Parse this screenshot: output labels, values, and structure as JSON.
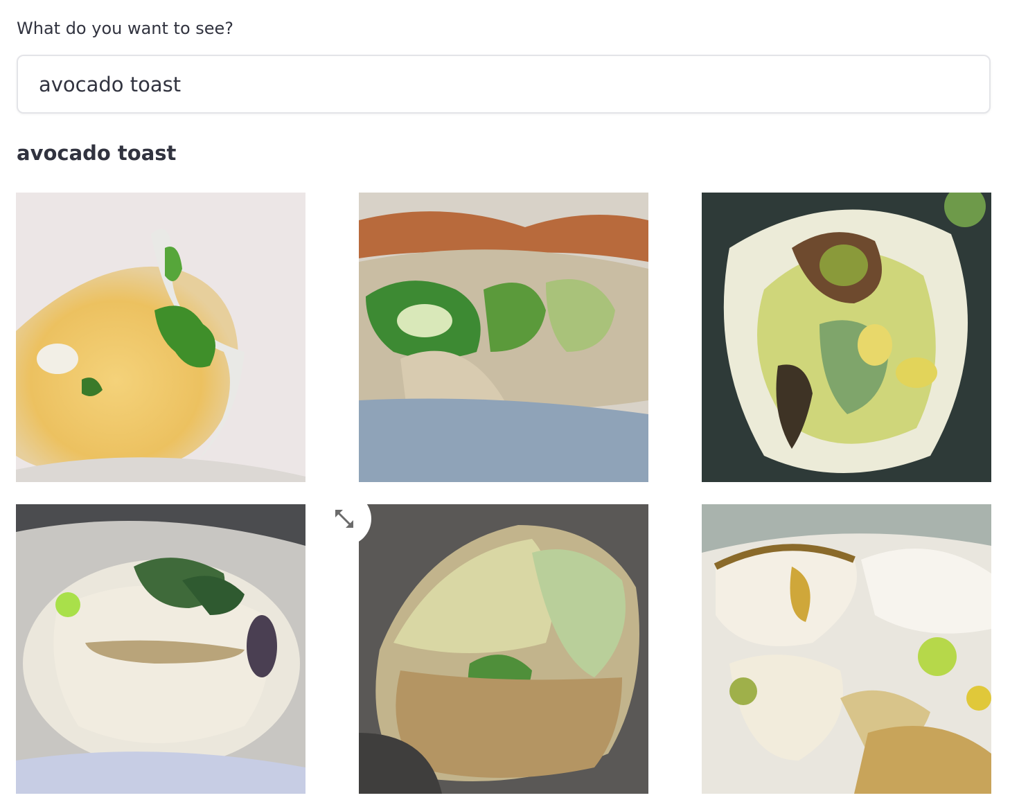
{
  "prompt": {
    "label": "What do you want to see?",
    "value": "avocado toast"
  },
  "result": {
    "heading": "avocado toast",
    "image_count": 6
  },
  "controls": {
    "expand_icon": "expand-arrows-icon"
  },
  "colors": {
    "text": "#31333f",
    "input_border": "#e3e4e8"
  }
}
